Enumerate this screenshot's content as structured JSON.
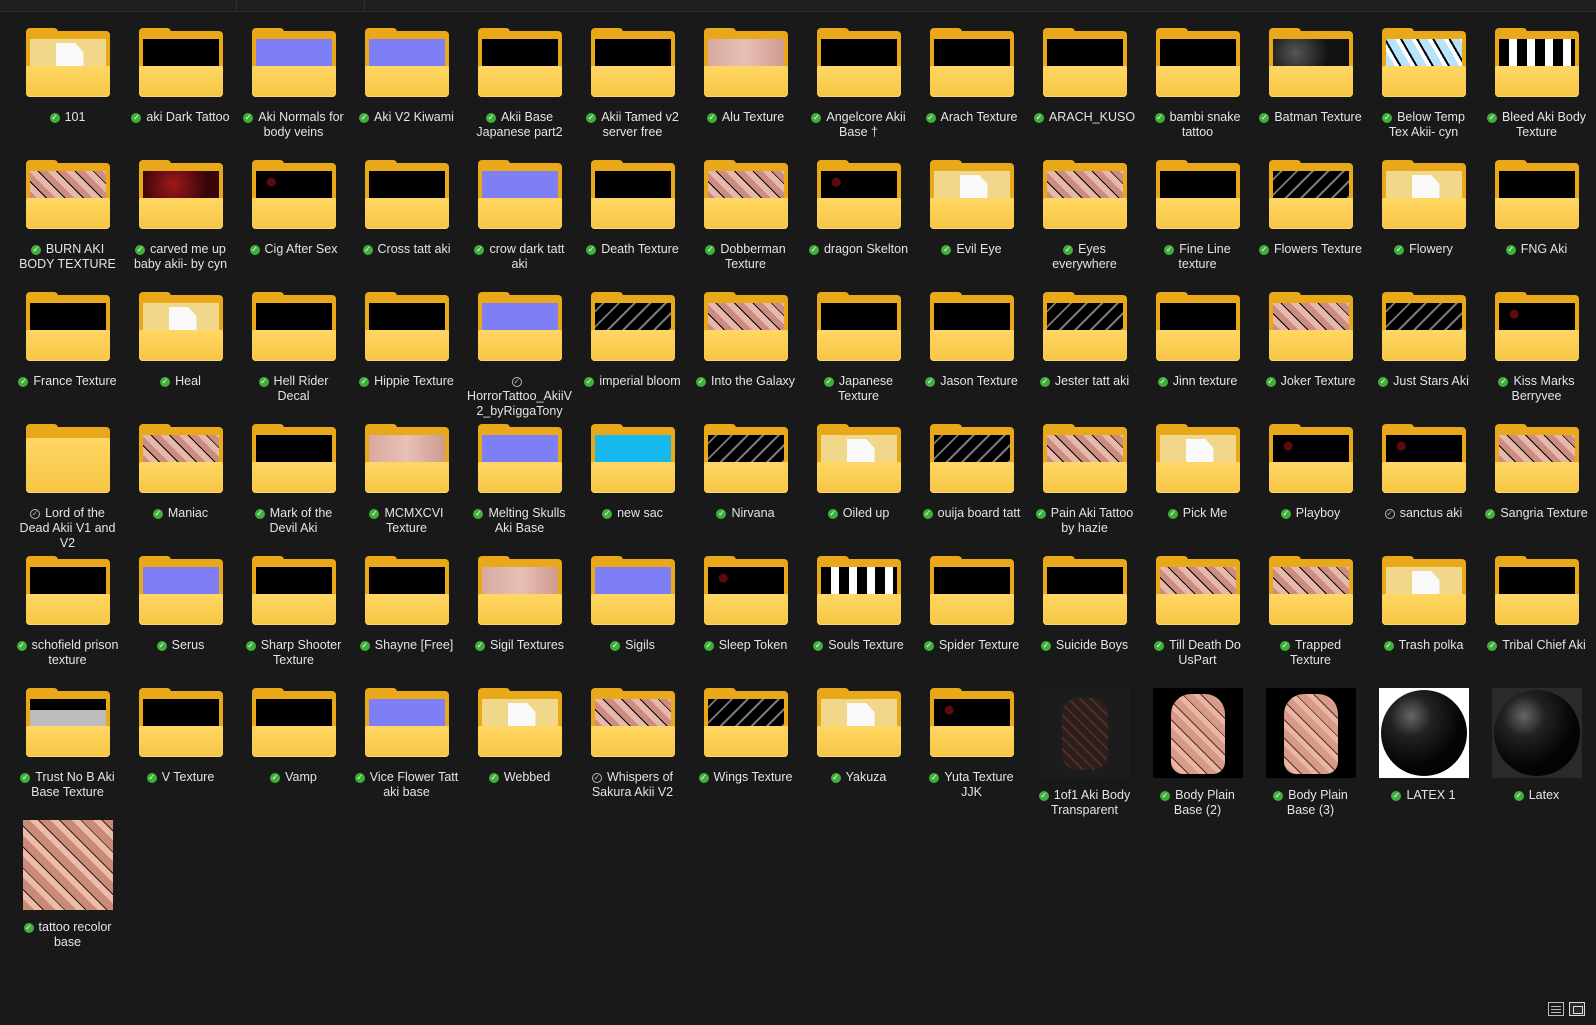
{
  "items": [
    {
      "label": "101",
      "type": "folder",
      "content": "paper"
    },
    {
      "label": "aki Dark Tattoo",
      "type": "folder",
      "content": "black"
    },
    {
      "label": "Aki Normals for body veins",
      "type": "folder",
      "content": "normal"
    },
    {
      "label": "Aki V2 Kiwami",
      "type": "folder",
      "content": "normal"
    },
    {
      "label": "Akii Base Japanese part2",
      "type": "folder",
      "content": "black"
    },
    {
      "label": "Akii Tamed v2 server free",
      "type": "folder",
      "content": "black"
    },
    {
      "label": "Alu Texture",
      "type": "folder",
      "content": "skin"
    },
    {
      "label": "Angelcore Akii Base †",
      "type": "folder",
      "content": "black"
    },
    {
      "label": "Arach Texture",
      "type": "folder",
      "content": "black"
    },
    {
      "label": "ARACH_KUSO",
      "type": "folder",
      "content": "black"
    },
    {
      "label": "bambi snake tattoo",
      "type": "folder",
      "content": "black"
    },
    {
      "label": "Batman Texture",
      "type": "folder",
      "content": "darkgray"
    },
    {
      "label": "Below Temp Tex Akii- cyn",
      "type": "folder",
      "content": "skyblue"
    },
    {
      "label": "Bleed Aki Body Texture",
      "type": "folder",
      "content": "whiteblack"
    },
    {
      "label": "BURN AKI BODY TEXTURE",
      "type": "folder",
      "content": "skinpattern"
    },
    {
      "label": "carved me up baby akii- by cyn",
      "type": "folder",
      "content": "red"
    },
    {
      "label": "Cig After Sex",
      "type": "folder",
      "content": "darkred"
    },
    {
      "label": "Cross tatt aki",
      "type": "folder",
      "content": "black"
    },
    {
      "label": "crow dark tatt aki",
      "type": "folder",
      "content": "normal"
    },
    {
      "label": "Death Texture",
      "type": "folder",
      "content": "black"
    },
    {
      "label": "Dobberman Texture",
      "type": "folder",
      "content": "skinpattern"
    },
    {
      "label": "dragon Skelton",
      "type": "folder",
      "content": "darkred"
    },
    {
      "label": "Evil Eye",
      "type": "folder",
      "content": "paper"
    },
    {
      "label": "Eyes everywhere",
      "type": "folder",
      "content": "skinpattern"
    },
    {
      "label": "Fine Line texture",
      "type": "folder",
      "content": "black"
    },
    {
      "label": "Flowers Texture",
      "type": "folder",
      "content": "graypattern"
    },
    {
      "label": "Flowery",
      "type": "folder",
      "content": "paper"
    },
    {
      "label": "FNG Aki",
      "type": "folder",
      "content": "black"
    },
    {
      "label": "France Texture",
      "type": "folder",
      "content": "black"
    },
    {
      "label": "Heal",
      "type": "folder",
      "content": "paper"
    },
    {
      "label": "Hell Rider Decal",
      "type": "folder",
      "content": "black"
    },
    {
      "label": "Hippie Texture",
      "type": "folder",
      "content": "black"
    },
    {
      "label": "HorrorTattoo_AkiiV2_byRiggaTony",
      "type": "folder",
      "content": "normal",
      "sync": "outline"
    },
    {
      "label": "imperial bloom",
      "type": "folder",
      "content": "graypattern"
    },
    {
      "label": "Into the Galaxy",
      "type": "folder",
      "content": "skinpattern"
    },
    {
      "label": "Japanese Texture",
      "type": "folder",
      "content": "black"
    },
    {
      "label": "Jason Texture",
      "type": "folder",
      "content": "black"
    },
    {
      "label": "Jester tatt aki",
      "type": "folder",
      "content": "graypattern"
    },
    {
      "label": "Jinn texture",
      "type": "folder",
      "content": "black"
    },
    {
      "label": "Joker Texture",
      "type": "folder",
      "content": "skinpattern"
    },
    {
      "label": "Just Stars Aki",
      "type": "folder",
      "content": "graypattern"
    },
    {
      "label": "Kiss Marks Berryvee",
      "type": "folder",
      "content": "darkred"
    },
    {
      "label": "Lord of the Dead Akii V1 and V2",
      "type": "folder",
      "content": "empty",
      "sync": "outline"
    },
    {
      "label": "Maniac",
      "type": "folder",
      "content": "skinpattern"
    },
    {
      "label": "Mark of the Devil Aki",
      "type": "folder",
      "content": "black"
    },
    {
      "label": "MCMXCVI Texture",
      "type": "folder",
      "content": "skin"
    },
    {
      "label": "Melting Skulls Aki Base",
      "type": "folder",
      "content": "normal"
    },
    {
      "label": "new sac",
      "type": "folder",
      "content": "cyan"
    },
    {
      "label": "Nirvana",
      "type": "folder",
      "content": "graypattern"
    },
    {
      "label": "Oiled up",
      "type": "folder",
      "content": "whitepaper"
    },
    {
      "label": "ouija board tatt",
      "type": "folder",
      "content": "graypattern"
    },
    {
      "label": "Pain Aki Tattoo by hazie",
      "type": "folder",
      "content": "skinpattern"
    },
    {
      "label": "Pick Me",
      "type": "folder",
      "content": "paper"
    },
    {
      "label": "Playboy",
      "type": "folder",
      "content": "darkred"
    },
    {
      "label": "sanctus aki",
      "type": "folder",
      "content": "darkred",
      "sync": "outline"
    },
    {
      "label": "Sangria Texture",
      "type": "folder",
      "content": "skinpattern"
    },
    {
      "label": "schofield prison texture",
      "type": "folder",
      "content": "black"
    },
    {
      "label": "Serus",
      "type": "folder",
      "content": "normal"
    },
    {
      "label": "Sharp Shooter Texture",
      "type": "folder",
      "content": "black"
    },
    {
      "label": "Shayne [Free]",
      "type": "folder",
      "content": "black"
    },
    {
      "label": "Sigil Textures",
      "type": "folder",
      "content": "skin"
    },
    {
      "label": "Sigils",
      "type": "folder",
      "content": "normal"
    },
    {
      "label": "Sleep Token",
      "type": "folder",
      "content": "darkred"
    },
    {
      "label": "Souls Texture",
      "type": "folder",
      "content": "whiteblack"
    },
    {
      "label": "Spider Texture",
      "type": "folder",
      "content": "black"
    },
    {
      "label": "Suicide Boys",
      "type": "folder",
      "content": "black"
    },
    {
      "label": "Till Death Do UsPart",
      "type": "folder",
      "content": "skinpattern"
    },
    {
      "label": "Trapped Texture",
      "type": "folder",
      "content": "skinpattern"
    },
    {
      "label": "Trash polka",
      "type": "folder",
      "content": "paper"
    },
    {
      "label": "Tribal Chief Aki",
      "type": "folder",
      "content": "black"
    },
    {
      "label": "Trust No B Aki Base Texture",
      "type": "folder",
      "content": "grayblack"
    },
    {
      "label": "V Texture",
      "type": "folder",
      "content": "black"
    },
    {
      "label": "Vamp",
      "type": "folder",
      "content": "black"
    },
    {
      "label": "Vice Flower Tatt aki base",
      "type": "folder",
      "content": "normal"
    },
    {
      "label": "Webbed",
      "type": "folder",
      "content": "paper"
    },
    {
      "label": "Whispers of Sakura Akii V2",
      "type": "folder",
      "content": "skinpattern",
      "sync": "outline"
    },
    {
      "label": "Wings Texture",
      "type": "folder",
      "content": "graypattern"
    },
    {
      "label": "Yakuza",
      "type": "folder",
      "content": "whitepaper"
    },
    {
      "label": "Yuta Texture JJK",
      "type": "folder",
      "content": "darkred"
    },
    {
      "label": "1of1 Aki Body Transparent",
      "type": "image",
      "content": "body-transparent"
    },
    {
      "label": "Body Plain Base (2)",
      "type": "image",
      "content": "body"
    },
    {
      "label": "Body Plain Base (3)",
      "type": "image",
      "content": "body"
    },
    {
      "label": "LATEX 1",
      "type": "image",
      "content": "sphere-white"
    },
    {
      "label": "Latex",
      "type": "image",
      "content": "sphere-dark"
    },
    {
      "label": "tattoo recolor base",
      "type": "image",
      "content": "body-square"
    }
  ],
  "status": {
    "sync_icon": "green-check-icon"
  },
  "colors": {
    "background": "#191919",
    "folder": "#f7c544",
    "folder_back": "#e8a819",
    "sync_green": "#3fb03a",
    "normal_map": "#7f7ff5"
  }
}
